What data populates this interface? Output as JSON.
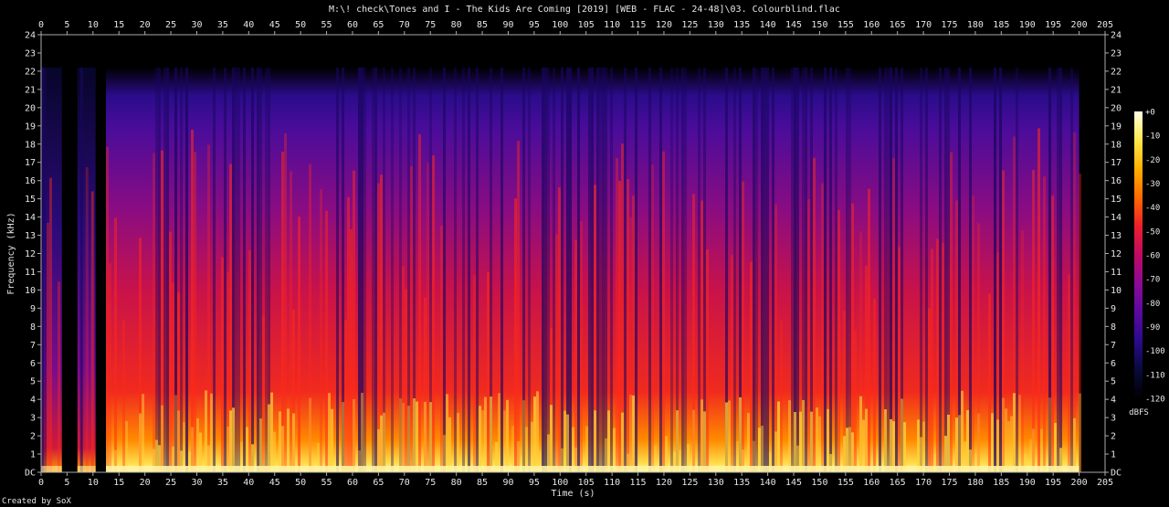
{
  "chart_data": {
    "type": "heatmap",
    "title": "M:\\! check\\Tones and I - The Kids Are Coming [2019] [WEB - FLAC - 24-48]\\03. Colourblind.flac",
    "xlabel": "Time (s)",
    "ylabel": "Frequency (kHz)",
    "xlim": [
      0,
      205
    ],
    "ylim": [
      0,
      24
    ],
    "x_ticks": [
      "0",
      "5",
      "10",
      "15",
      "20",
      "25",
      "30",
      "35",
      "40",
      "45",
      "50",
      "55",
      "60",
      "65",
      "70",
      "75",
      "80",
      "85",
      "90",
      "95",
      "100",
      "105",
      "110",
      "115",
      "120",
      "125",
      "130",
      "135",
      "140",
      "145",
      "150",
      "155",
      "160",
      "165",
      "170",
      "175",
      "180",
      "185",
      "190",
      "195",
      "200",
      "205"
    ],
    "y_ticks": [
      "DC",
      "1",
      "2",
      "3",
      "4",
      "5",
      "6",
      "7",
      "8",
      "9",
      "10",
      "11",
      "12",
      "13",
      "14",
      "15",
      "16",
      "17",
      "18",
      "19",
      "20",
      "21",
      "22",
      "23",
      "24"
    ],
    "colorbar": {
      "label": "dBFS",
      "ticks": [
        "+0",
        "-10",
        "-20",
        "-30",
        "-40",
        "-50",
        "-60",
        "-70",
        "-80",
        "-90",
        "-100",
        "-110",
        "-120"
      ],
      "range": [
        -120,
        0
      ],
      "colors": [
        "#000000",
        "#0a0a3c",
        "#2a0a8c",
        "#5a0aa0",
        "#8c0a96",
        "#c00a64",
        "#ee1e2a",
        "#ff6a00",
        "#ffb000",
        "#ffe84a",
        "#ffffe8"
      ]
    },
    "duration_s": 200,
    "cutoff_khz": 22.2,
    "events": [
      {
        "start": 0,
        "end": 4,
        "level": 0.45
      },
      {
        "start": 7,
        "end": 10.5,
        "level": 0.5
      },
      {
        "start": 12.5,
        "end": 200,
        "level": 0.85
      }
    ]
  },
  "footer": {
    "credit": "Created by SoX"
  }
}
